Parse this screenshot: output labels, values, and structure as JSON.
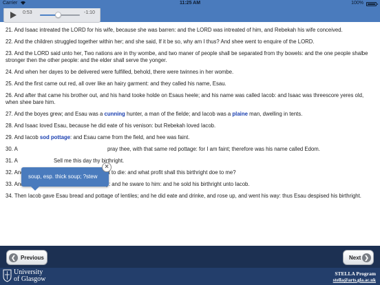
{
  "status_bar": {
    "carrier": "Carrier",
    "time": "11:25 AM",
    "battery": "100%",
    "battery_level": 1.0
  },
  "audio_player": {
    "elapsed": "0:53",
    "remaining": "-1:10",
    "progress": 0.45,
    "play_icon": "play-icon"
  },
  "verses": [
    {
      "text": "21.  And Isaac intreated the LORD for his wife, because she was barren: and the LORD was intreated of him, and Rebekah his wife conceived."
    },
    {
      "text": "22.  And the children struggled together within her; and she said, If it be so, why am I thus?  And shee went to enquire of the LORD."
    },
    {
      "text": "23.  And the LORD said unto her, Two nations are in thy wombe, and two maner of people shall be separated from thy bowels: and the one people shalbe stronger then the other people: and the elder shall serve the yonger."
    },
    {
      "text": "24.  And when her dayes to be delivered were fulfilled, behold, there were twinnes in her wombe."
    },
    {
      "text": "25.  And the first came out red, all over like an hairy garment: and they called his name, Esau."
    },
    {
      "text": "26.  And after that came his brother out, and his hand tooke holde on Esaus heele; and his name was called Iacob: and Isaac was threescore yeres old, when shee bare him."
    },
    {
      "before": "27.  And the boyes grew; and Esau was a ",
      "hl1": "cunning",
      "middle": " hunter, a man of the fielde; and Iacob was a ",
      "hl2": "plaine",
      "after": " man, dwelling in tents."
    },
    {
      "text": "28.  And Isaac loved Esau, because he did eate of his venison: but Rebekah loved Iacob."
    },
    {
      "before": "29.  And Iacob ",
      "hl1": "sod pottage",
      "after": ": and Esau came from the field, and hee was faint."
    },
    {
      "before": "30.  A",
      "after": " pray thee, with that same red pottage: for I am faint; therefore was his name called Edom."
    },
    {
      "before": "31.  A",
      "after": " Sell me this day thy birthright."
    },
    {
      "text": "32.  And Esau said, Behold, I am at the point to die: and what profit shall this birthright doe to me?"
    },
    {
      "text": "33.  And Iacob said, Sweare to mee this day: and he sware to him: and he sold his birthright unto Iacob."
    },
    {
      "text": "34.  Then Iacob gave Esau bread and pottage of lentiles; and he did eate and drinke, and rose up, and went his way: thus Esau despised his birthright."
    }
  ],
  "tooltip": {
    "text": "soup, esp. thick soup; ?stew",
    "close_icon": "close-icon"
  },
  "navigation": {
    "previous_label": "Previous",
    "next_label": "Next",
    "previous_icon": "chevron-left-icon",
    "next_icon": "chevron-right-icon"
  },
  "footer": {
    "university_line1": "University",
    "university_line2": "of Glasgow",
    "program": "STELLA Program",
    "email": "stella@arts.gla.ac.uk"
  },
  "colors": {
    "header_blue": "#4a7bbd",
    "nav_bar": "#1c3052",
    "footer": "#233e6b",
    "highlight_word": "#1a3fb0"
  }
}
